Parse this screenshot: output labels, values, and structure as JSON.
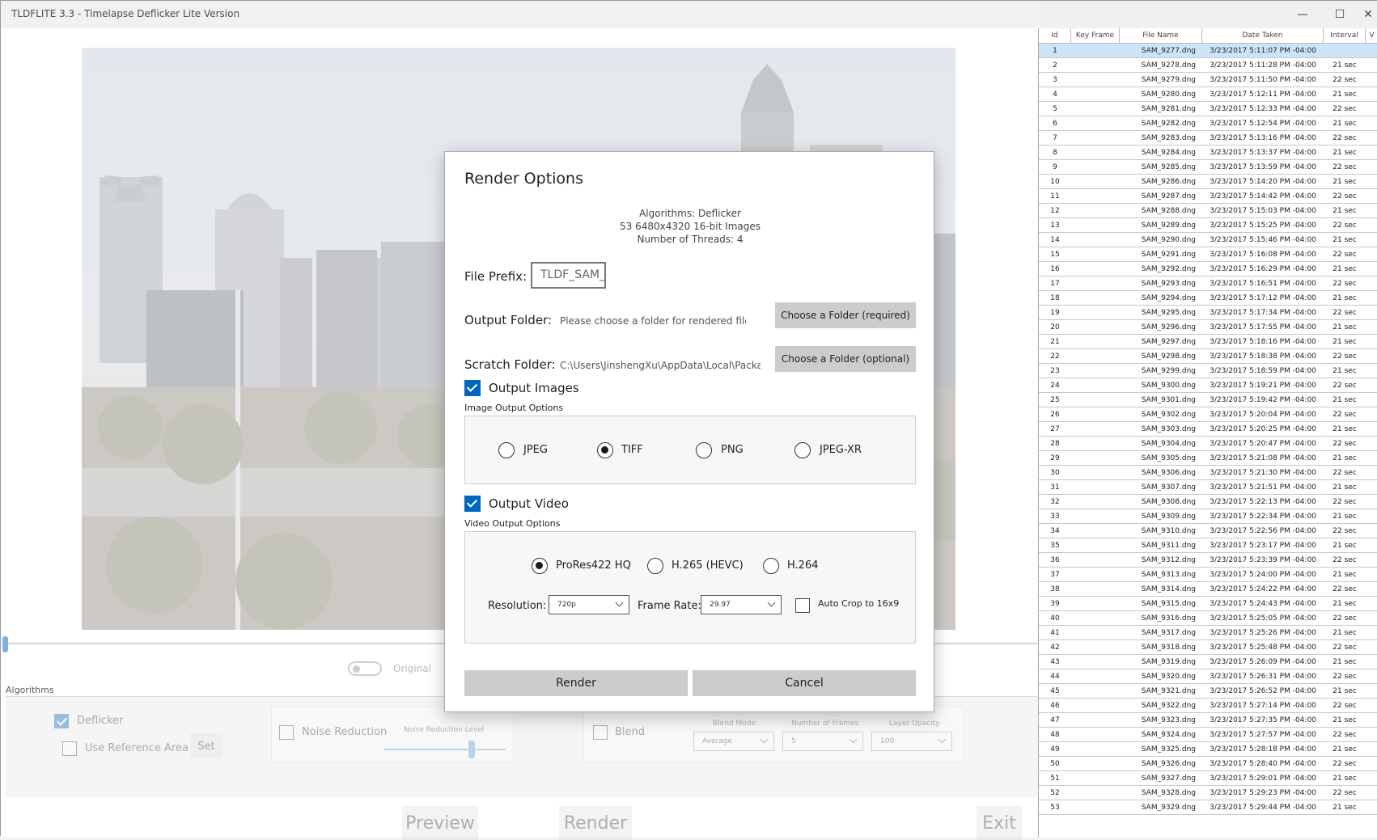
{
  "window": {
    "title": "TLDFLITE 3.3 - Timelapse Deflicker Lite Version",
    "minimize": "—",
    "maximize": "☐",
    "close": "✕"
  },
  "viewer": {
    "toggle_label": "Original"
  },
  "algorithms": {
    "section_label": "Algorithms",
    "deflicker": "Deflicker",
    "use_reference_area": "Use Reference Area",
    "set_label": "Set",
    "noise_reduction": "Noise Reduction",
    "noise_reduction_level": "Noise Reduction Level",
    "noise_reduction_value": 0.72,
    "blend": "Blend",
    "blend_mode_label": "Blend Mode",
    "blend_mode_value": "Average",
    "frames_label": "Number of Frames",
    "frames_value": "5",
    "opacity_label": "Layer Opacity",
    "opacity_value": "100"
  },
  "bottom_buttons": {
    "preview": "Preview",
    "render": "Render",
    "exit": "Exit"
  },
  "table": {
    "headers": [
      "Id",
      "Key Frame",
      "File Name",
      "Date Taken",
      "Interval",
      "V"
    ],
    "rows": [
      [
        "1",
        "",
        "SAM_9277.dng",
        "3/23/2017 5:11:07 PM -04:00",
        ""
      ],
      [
        "2",
        "",
        "SAM_9278.dng",
        "3/23/2017 5:11:28 PM -04:00",
        "21 sec"
      ],
      [
        "3",
        "",
        "SAM_9279.dng",
        "3/23/2017 5:11:50 PM -04:00",
        "22 sec"
      ],
      [
        "4",
        "",
        "SAM_9280.dng",
        "3/23/2017 5:12:11 PM -04:00",
        "21 sec"
      ],
      [
        "5",
        "",
        "SAM_9281.dng",
        "3/23/2017 5:12:33 PM -04:00",
        "22 sec"
      ],
      [
        "6",
        "",
        "SAM_9282.dng",
        "3/23/2017 5:12:54 PM -04:00",
        "21 sec"
      ],
      [
        "7",
        "",
        "SAM_9283.dng",
        "3/23/2017 5:13:16 PM -04:00",
        "22 sec"
      ],
      [
        "8",
        "",
        "SAM_9284.dng",
        "3/23/2017 5:13:37 PM -04:00",
        "21 sec"
      ],
      [
        "9",
        "",
        "SAM_9285.dng",
        "3/23/2017 5:13:59 PM -04:00",
        "22 sec"
      ],
      [
        "10",
        "",
        "SAM_9286.dng",
        "3/23/2017 5:14:20 PM -04:00",
        "21 sec"
      ],
      [
        "11",
        "",
        "SAM_9287.dng",
        "3/23/2017 5:14:42 PM -04:00",
        "22 sec"
      ],
      [
        "12",
        "",
        "SAM_9288.dng",
        "3/23/2017 5:15:03 PM -04:00",
        "21 sec"
      ],
      [
        "13",
        "",
        "SAM_9289.dng",
        "3/23/2017 5:15:25 PM -04:00",
        "22 sec"
      ],
      [
        "14",
        "",
        "SAM_9290.dng",
        "3/23/2017 5:15:46 PM -04:00",
        "21 sec"
      ],
      [
        "15",
        "",
        "SAM_9291.dng",
        "3/23/2017 5:16:08 PM -04:00",
        "22 sec"
      ],
      [
        "16",
        "",
        "SAM_9292.dng",
        "3/23/2017 5:16:29 PM -04:00",
        "21 sec"
      ],
      [
        "17",
        "",
        "SAM_9293.dng",
        "3/23/2017 5:16:51 PM -04:00",
        "22 sec"
      ],
      [
        "18",
        "",
        "SAM_9294.dng",
        "3/23/2017 5:17:12 PM -04:00",
        "21 sec"
      ],
      [
        "19",
        "",
        "SAM_9295.dng",
        "3/23/2017 5:17:34 PM -04:00",
        "22 sec"
      ],
      [
        "20",
        "",
        "SAM_9296.dng",
        "3/23/2017 5:17:55 PM -04:00",
        "21 sec"
      ],
      [
        "21",
        "",
        "SAM_9297.dng",
        "3/23/2017 5:18:16 PM -04:00",
        "21 sec"
      ],
      [
        "22",
        "",
        "SAM_9298.dng",
        "3/23/2017 5:18:38 PM -04:00",
        "22 sec"
      ],
      [
        "23",
        "",
        "SAM_9299.dng",
        "3/23/2017 5:18:59 PM -04:00",
        "21 sec"
      ],
      [
        "24",
        "",
        "SAM_9300.dng",
        "3/23/2017 5:19:21 PM -04:00",
        "22 sec"
      ],
      [
        "25",
        "",
        "SAM_9301.dng",
        "3/23/2017 5:19:42 PM -04:00",
        "21 sec"
      ],
      [
        "26",
        "",
        "SAM_9302.dng",
        "3/23/2017 5:20:04 PM -04:00",
        "22 sec"
      ],
      [
        "27",
        "",
        "SAM_9303.dng",
        "3/23/2017 5:20:25 PM -04:00",
        "21 sec"
      ],
      [
        "28",
        "",
        "SAM_9304.dng",
        "3/23/2017 5:20:47 PM -04:00",
        "22 sec"
      ],
      [
        "29",
        "",
        "SAM_9305.dng",
        "3/23/2017 5:21:08 PM -04:00",
        "21 sec"
      ],
      [
        "30",
        "",
        "SAM_9306.dng",
        "3/23/2017 5:21:30 PM -04:00",
        "22 sec"
      ],
      [
        "31",
        "",
        "SAM_9307.dng",
        "3/23/2017 5:21:51 PM -04:00",
        "21 sec"
      ],
      [
        "32",
        "",
        "SAM_9308.dng",
        "3/23/2017 5:22:13 PM -04:00",
        "22 sec"
      ],
      [
        "33",
        "",
        "SAM_9309.dng",
        "3/23/2017 5:22:34 PM -04:00",
        "21 sec"
      ],
      [
        "34",
        "",
        "SAM_9310.dng",
        "3/23/2017 5:22:56 PM -04:00",
        "22 sec"
      ],
      [
        "35",
        "",
        "SAM_9311.dng",
        "3/23/2017 5:23:17 PM -04:00",
        "21 sec"
      ],
      [
        "36",
        "",
        "SAM_9312.dng",
        "3/23/2017 5:23:39 PM -04:00",
        "22 sec"
      ],
      [
        "37",
        "",
        "SAM_9313.dng",
        "3/23/2017 5:24:00 PM -04:00",
        "21 sec"
      ],
      [
        "38",
        "",
        "SAM_9314.dng",
        "3/23/2017 5:24:22 PM -04:00",
        "22 sec"
      ],
      [
        "39",
        "",
        "SAM_9315.dng",
        "3/23/2017 5:24:43 PM -04:00",
        "21 sec"
      ],
      [
        "40",
        "",
        "SAM_9316.dng",
        "3/23/2017 5:25:05 PM -04:00",
        "22 sec"
      ],
      [
        "41",
        "",
        "SAM_9317.dng",
        "3/23/2017 5:25:26 PM -04:00",
        "21 sec"
      ],
      [
        "42",
        "",
        "SAM_9318.dng",
        "3/23/2017 5:25:48 PM -04:00",
        "22 sec"
      ],
      [
        "43",
        "",
        "SAM_9319.dng",
        "3/23/2017 5:26:09 PM -04:00",
        "21 sec"
      ],
      [
        "44",
        "",
        "SAM_9320.dng",
        "3/23/2017 5:26:31 PM -04:00",
        "22 sec"
      ],
      [
        "45",
        "",
        "SAM_9321.dng",
        "3/23/2017 5:26:52 PM -04:00",
        "21 sec"
      ],
      [
        "46",
        "",
        "SAM_9322.dng",
        "3/23/2017 5:27:14 PM -04:00",
        "22 sec"
      ],
      [
        "47",
        "",
        "SAM_9323.dng",
        "3/23/2017 5:27:35 PM -04:00",
        "21 sec"
      ],
      [
        "48",
        "",
        "SAM_9324.dng",
        "3/23/2017 5:27:57 PM -04:00",
        "22 sec"
      ],
      [
        "49",
        "",
        "SAM_9325.dng",
        "3/23/2017 5:28:18 PM -04:00",
        "21 sec"
      ],
      [
        "50",
        "",
        "SAM_9326.dng",
        "3/23/2017 5:28:40 PM -04:00",
        "22 sec"
      ],
      [
        "51",
        "",
        "SAM_9327.dng",
        "3/23/2017 5:29:01 PM -04:00",
        "21 sec"
      ],
      [
        "52",
        "",
        "SAM_9328.dng",
        "3/23/2017 5:29:23 PM -04:00",
        "22 sec"
      ],
      [
        "53",
        "",
        "SAM_9329.dng",
        "3/23/2017 5:29:44 PM -04:00",
        "21 sec"
      ]
    ]
  },
  "dialog": {
    "title": "Render Options",
    "info_algorithms": "Algorithms: Deflicker",
    "info_images": "53 6480x4320 16-bit Images",
    "info_threads": "Number of Threads: 4",
    "file_prefix_label": "File Prefix:",
    "file_prefix_value": "TLDF_SAM_",
    "output_folder_label": "Output Folder:",
    "output_folder_hint": "Please choose a folder for rendered files",
    "output_folder_button": "Choose a Folder (required)",
    "scratch_folder_label": "Scratch Folder:",
    "scratch_folder_value": "C:\\Users\\JinshengXu\\AppData\\Local\\Packages",
    "scratch_folder_button": "Choose a Folder (optional)",
    "output_images_label": "Output Images",
    "image_options_label": "Image Output Options",
    "image_formats": [
      "JPEG",
      "TIFF",
      "PNG",
      "JPEG-XR"
    ],
    "image_format_selected": "TIFF",
    "output_video_label": "Output Video",
    "video_options_label": "Video Output Options",
    "video_codecs": [
      "ProRes422 HQ",
      "H.265 (HEVC)",
      "H.264"
    ],
    "video_codec_selected": "ProRes422 HQ",
    "resolution_label": "Resolution:",
    "resolution_value": "720p",
    "frame_rate_label": "Frame Rate:",
    "frame_rate_value": "29.97",
    "auto_crop_label": "Auto Crop to 16x9",
    "render_button": "Render",
    "cancel_button": "Cancel"
  }
}
